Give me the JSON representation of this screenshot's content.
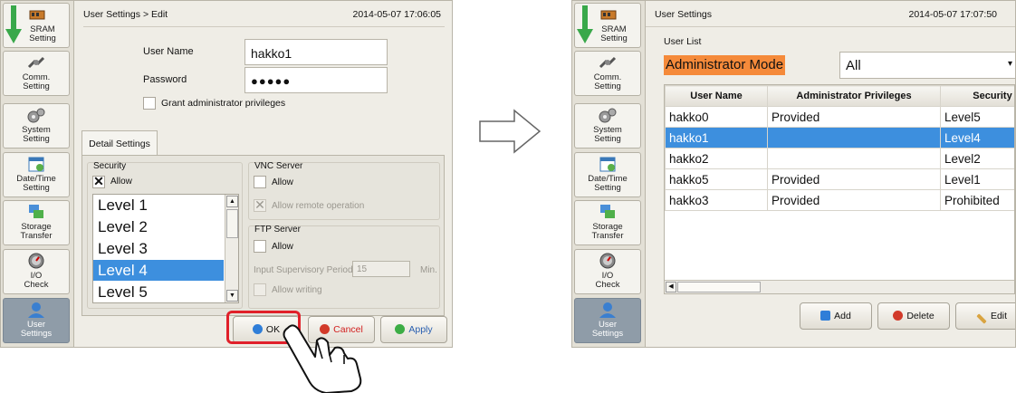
{
  "sidebar": {
    "items": [
      {
        "label": "SRAM\nSetting",
        "icon": "memory-card-icon"
      },
      {
        "label": "Comm.\nSetting",
        "icon": "plug-icon"
      },
      {
        "label": "System\nSetting",
        "icon": "gears-icon"
      },
      {
        "label": "Date/Time\nSetting",
        "icon": "calendar-clock-icon"
      },
      {
        "label": "Storage\nTransfer",
        "icon": "storage-transfer-icon"
      },
      {
        "label": "I/O\nCheck",
        "icon": "gauge-icon"
      },
      {
        "label": "User\nSettings",
        "icon": "user-icon"
      }
    ]
  },
  "left": {
    "breadcrumb": "User Settings > Edit",
    "timestamp": "2014-05-07  17:06:05",
    "user_name_label": "User Name",
    "user_name_value": "hakko1",
    "password_label": "Password",
    "password_value": "●●●●●",
    "grant_admin_label": "Grant administrator privileges",
    "detail_tab": "Detail Settings",
    "security": {
      "title": "Security",
      "allow_label": "Allow",
      "allow_checked": true,
      "levels": [
        "Level 1",
        "Level 2",
        "Level 3",
        "Level 4",
        "Level 5"
      ],
      "selected_index": 3
    },
    "vnc": {
      "title": "VNC Server",
      "allow_label": "Allow",
      "remote_label": "Allow remote operation"
    },
    "ftp": {
      "title": "FTP Server",
      "allow_label": "Allow",
      "period_label": "Input Supervisory Period",
      "period_value": "15",
      "period_unit": "Min.",
      "writing_label": "Allow writing"
    },
    "buttons": {
      "ok": "OK",
      "cancel": "Cancel",
      "apply": "Apply"
    }
  },
  "right": {
    "title": "User Settings",
    "timestamp": "2014-05-07  17:07:50",
    "list_label": "User List",
    "mode_label": "Administrator Mode",
    "mode_value": "All",
    "columns": [
      "User Name",
      "Administrator Privileges",
      "Security"
    ],
    "rows": [
      [
        "hakko0",
        "Provided",
        "Level5"
      ],
      [
        "hakko1",
        "",
        "Level4"
      ],
      [
        "hakko2",
        "",
        "Level2"
      ],
      [
        "hakko5",
        "Provided",
        "Level1"
      ],
      [
        "hakko3",
        "Provided",
        "Prohibited"
      ]
    ],
    "selected_row": 1,
    "buttons": {
      "add": "Add",
      "delete": "Delete",
      "edit": "Edit"
    }
  },
  "colors": {
    "accent_blue": "#3d8fde",
    "ok_highlight": "#e0202a",
    "mode_label_bg": "#f58a3a",
    "cancel_text": "#d22020"
  }
}
